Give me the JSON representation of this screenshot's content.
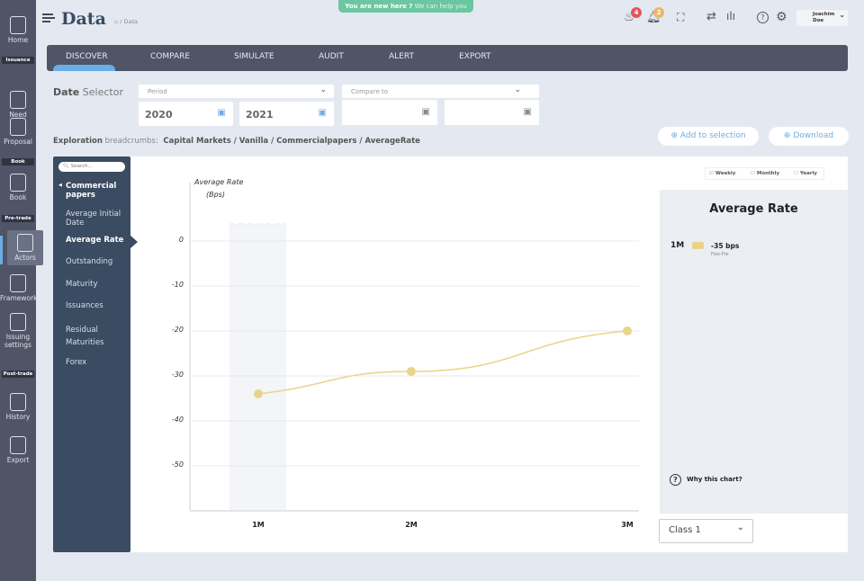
{
  "header": {
    "title": "Data",
    "breadcrumb": "/ Data",
    "banner_bold": "You are new here ?",
    "banner_link": "We can help you",
    "notif_fire": "4",
    "notif_bell": "2",
    "user": "Joachim Doe"
  },
  "leftnav": {
    "items": [
      {
        "label": "Home"
      },
      {
        "section": "Issuance",
        "label": "Need"
      },
      {
        "label": "Proposal"
      },
      {
        "section": "Book",
        "label": "Book"
      },
      {
        "section": "Pre-trade",
        "label": "Actors"
      },
      {
        "label": "Framework"
      },
      {
        "label": "Issuing settings"
      },
      {
        "section": "Post-trade",
        "label": "History"
      },
      {
        "label": "Export"
      }
    ]
  },
  "tabs": [
    "DISCOVER",
    "COMPARE",
    "SIMULATE",
    "AUDIT",
    "ALERT",
    "EXPORT"
  ],
  "date_selector": {
    "label_bold": "Date",
    "label": "Selector",
    "period_placeholder": "Period",
    "compare_placeholder": "Compare to",
    "from": "2020",
    "to": "2021"
  },
  "exploration": {
    "label_bold": "Exploration",
    "label": "breadcrumbs:",
    "path": "Capital Markets / Vanilla / Commercialpapers / AverageRate"
  },
  "actions": {
    "add": "Add to selection",
    "download": "Download"
  },
  "menu": {
    "search_placeholder": "Search...",
    "group": "Commercial papers",
    "items": [
      "Average Initial Date",
      "Average Rate",
      "Outstanding",
      "Maturity",
      "Issuances",
      "Residual Maturities",
      "Forex"
    ],
    "active": "Average Rate"
  },
  "frequency": {
    "options": [
      "Weekly",
      "Monthly",
      "Yearly"
    ],
    "checked": "Weekly"
  },
  "legend": {
    "title": "Average Rate",
    "series": "1M",
    "value": "-35 bps",
    "sub": "Fixe-Pre",
    "why": "Why this chart?",
    "color": "#e8d48a"
  },
  "class_select": "Class 1",
  "chart_data": {
    "type": "line",
    "ylabel": "Average Rate",
    "yunit": "(Bps)",
    "categories": [
      "1M",
      "2M",
      "3M"
    ],
    "values": [
      -34,
      -29,
      -20
    ],
    "yticks": [
      0,
      -10,
      -20,
      -30,
      -40,
      -50
    ],
    "ylim": [
      -60,
      3
    ],
    "grid": true,
    "highlight_category": "1M",
    "color": "#e8d48a"
  }
}
